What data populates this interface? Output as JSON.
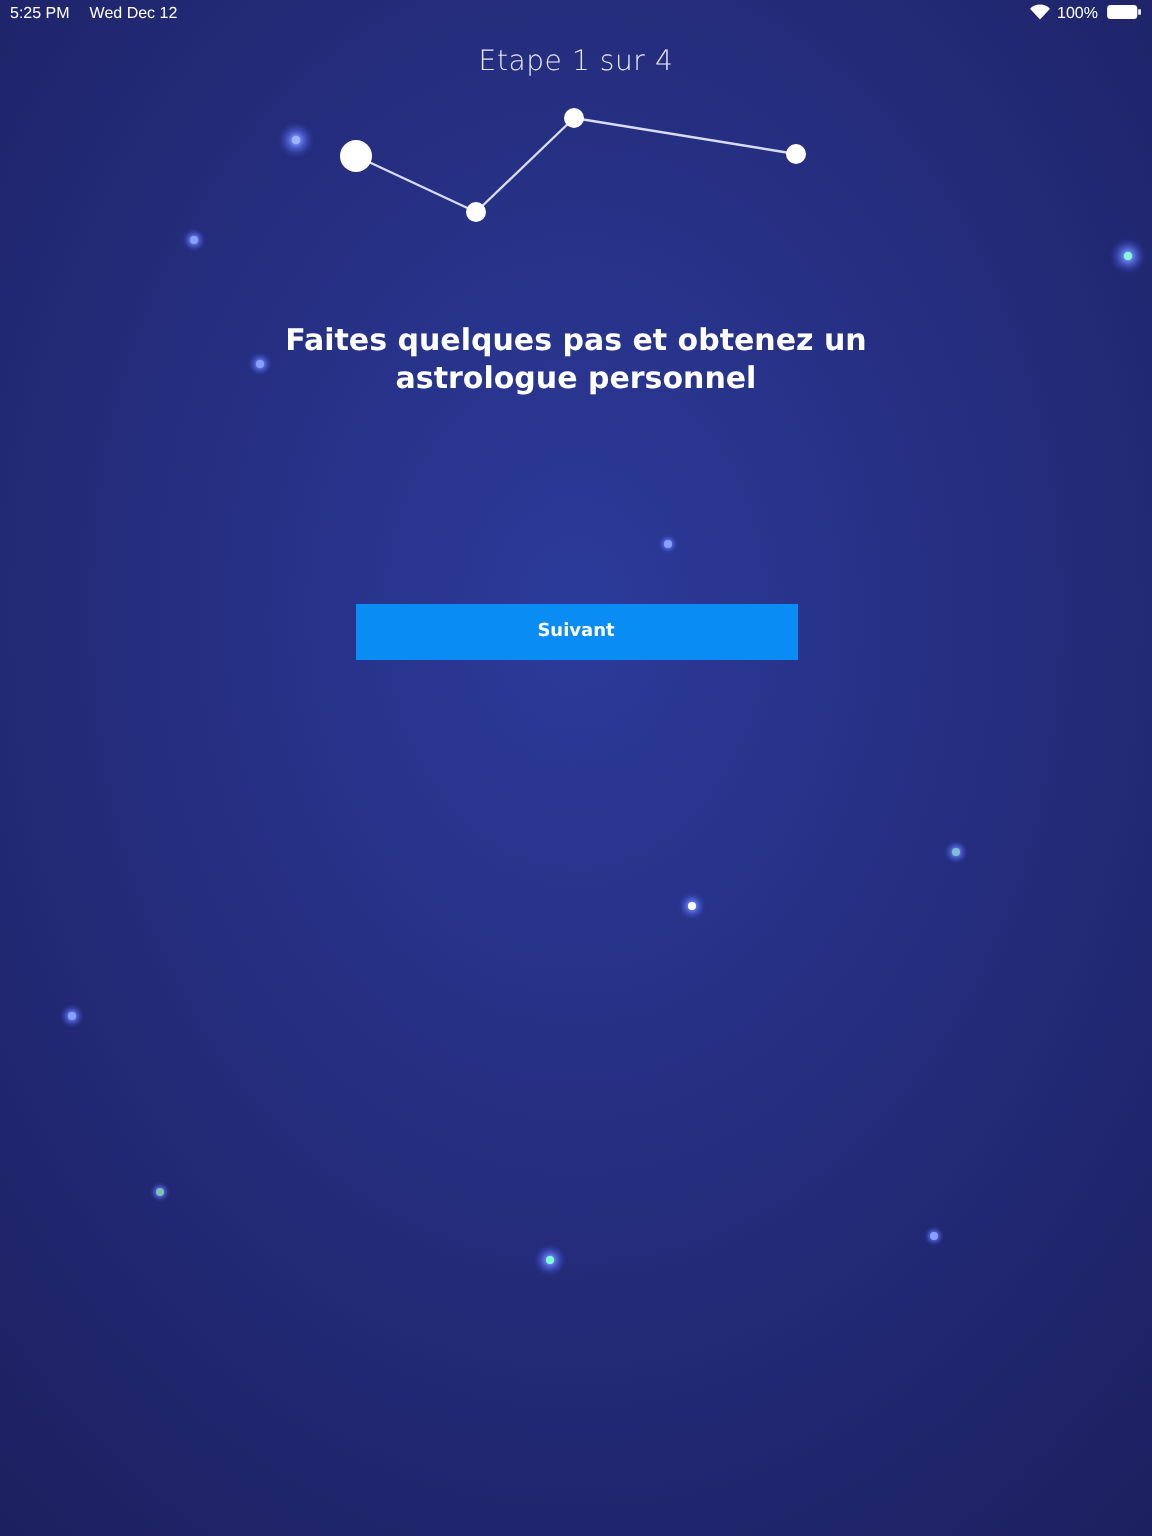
{
  "status_bar": {
    "time": "5:25 PM",
    "date": "Wed Dec 12",
    "battery": "100%"
  },
  "step_label": "Etape 1 sur 4",
  "steps": [
    {
      "selected": true
    },
    {
      "selected": false
    },
    {
      "selected": false
    },
    {
      "selected": false
    }
  ],
  "heading": "Faites quelques pas et obtenez un astrologue personnel",
  "button": "Suivant"
}
